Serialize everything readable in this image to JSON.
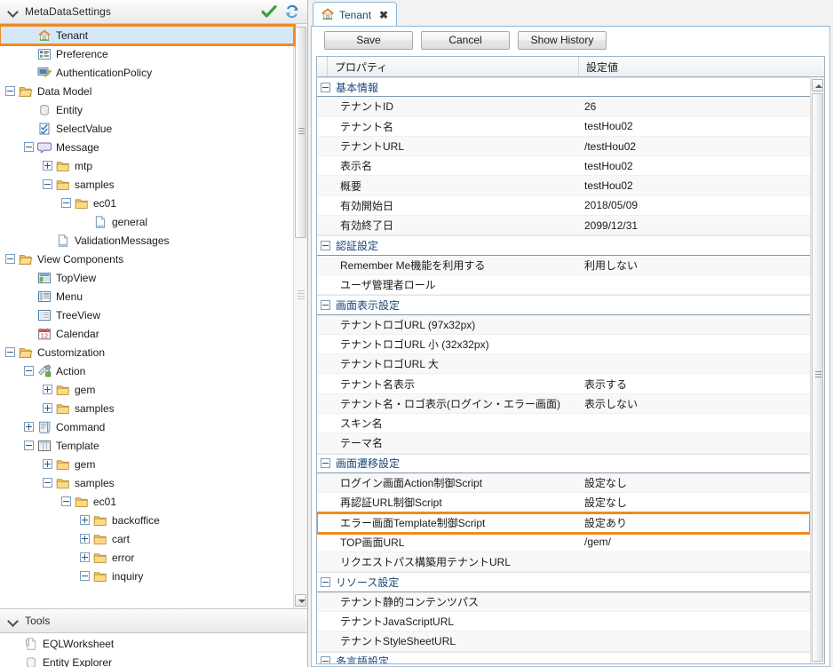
{
  "left_panel": {
    "metadata_section": {
      "title": "MetaDataSettings",
      "validate_icon": "check-icon",
      "refresh_icon": "refresh-icon"
    },
    "tree": [
      {
        "label": "Tenant",
        "depth": 1,
        "twist": "none",
        "icon": "home-icon",
        "selected": true,
        "highlighted": true
      },
      {
        "label": "Preference",
        "depth": 1,
        "twist": "none",
        "icon": "preference-icon"
      },
      {
        "label": "AuthenticationPolicy",
        "depth": 1,
        "twist": "none",
        "icon": "auth-policy-icon"
      },
      {
        "label": "Data Model",
        "depth": 0,
        "twist": "minus",
        "icon": "folder-open-icon"
      },
      {
        "label": "Entity",
        "depth": 1,
        "twist": "none",
        "icon": "entity-icon"
      },
      {
        "label": "SelectValue",
        "depth": 1,
        "twist": "none",
        "icon": "selectvalue-icon"
      },
      {
        "label": "Message",
        "depth": 1,
        "twist": "minus",
        "icon": "message-icon"
      },
      {
        "label": "mtp",
        "depth": 2,
        "twist": "plus",
        "icon": "folder-icon"
      },
      {
        "label": "samples",
        "depth": 2,
        "twist": "minus",
        "icon": "folder-icon"
      },
      {
        "label": "ec01",
        "depth": 3,
        "twist": "minus",
        "icon": "folder-icon"
      },
      {
        "label": "general",
        "depth": 4,
        "twist": "none",
        "icon": "file-icon"
      },
      {
        "label": "ValidationMessages",
        "depth": 2,
        "twist": "none",
        "icon": "file-icon"
      },
      {
        "label": "View Components",
        "depth": 0,
        "twist": "minus",
        "icon": "folder-open-icon"
      },
      {
        "label": "TopView",
        "depth": 1,
        "twist": "none",
        "icon": "topview-icon"
      },
      {
        "label": "Menu",
        "depth": 1,
        "twist": "none",
        "icon": "menu-icon"
      },
      {
        "label": "TreeView",
        "depth": 1,
        "twist": "none",
        "icon": "treeview-icon"
      },
      {
        "label": "Calendar",
        "depth": 1,
        "twist": "none",
        "icon": "calendar-icon"
      },
      {
        "label": "Customization",
        "depth": 0,
        "twist": "minus",
        "icon": "folder-open-icon"
      },
      {
        "label": "Action",
        "depth": 1,
        "twist": "minus",
        "icon": "action-icon"
      },
      {
        "label": "gem",
        "depth": 2,
        "twist": "plus",
        "icon": "folder-icon"
      },
      {
        "label": "samples",
        "depth": 2,
        "twist": "plus",
        "icon": "folder-icon"
      },
      {
        "label": "Command",
        "depth": 1,
        "twist": "plus",
        "icon": "command-icon"
      },
      {
        "label": "Template",
        "depth": 1,
        "twist": "minus",
        "icon": "template-icon"
      },
      {
        "label": "gem",
        "depth": 2,
        "twist": "plus",
        "icon": "folder-icon"
      },
      {
        "label": "samples",
        "depth": 2,
        "twist": "minus",
        "icon": "folder-icon"
      },
      {
        "label": "ec01",
        "depth": 3,
        "twist": "minus",
        "icon": "folder-icon"
      },
      {
        "label": "backoffice",
        "depth": 4,
        "twist": "plus",
        "icon": "folder-icon"
      },
      {
        "label": "cart",
        "depth": 4,
        "twist": "plus",
        "icon": "folder-icon"
      },
      {
        "label": "error",
        "depth": 4,
        "twist": "plus",
        "icon": "folder-icon"
      },
      {
        "label": "inquiry",
        "depth": 4,
        "twist": "minus",
        "icon": "folder-icon"
      }
    ],
    "tools_section": {
      "title": "Tools",
      "items": [
        {
          "label": "EQLWorksheet",
          "icon": "worksheet-icon"
        },
        {
          "label": "Entity Explorer",
          "icon": "entity-explorer-icon"
        }
      ]
    }
  },
  "right_panel": {
    "tab": {
      "label": "Tenant",
      "icon": "home-icon",
      "close": "✖"
    },
    "toolbar": {
      "save_label": "Save",
      "cancel_label": "Cancel",
      "history_label": "Show History"
    },
    "grid": {
      "columns": [
        "プロパティ",
        "設定値"
      ],
      "rows": [
        {
          "type": "group",
          "name": "基本情報",
          "value": ""
        },
        {
          "type": "item",
          "name": "テナントID",
          "value": "26"
        },
        {
          "type": "item",
          "name": "テナント名",
          "value": "testHou02"
        },
        {
          "type": "item",
          "name": "テナントURL",
          "value": "/testHou02"
        },
        {
          "type": "item",
          "name": "表示名",
          "value": "testHou02"
        },
        {
          "type": "item",
          "name": "概要",
          "value": "testHou02"
        },
        {
          "type": "item",
          "name": "有効開始日",
          "value": "2018/05/09"
        },
        {
          "type": "item",
          "name": "有効終了日",
          "value": "2099/12/31"
        },
        {
          "type": "group",
          "name": "認証設定",
          "value": ""
        },
        {
          "type": "item",
          "name": "Remember Me機能を利用する",
          "value": "利用しない"
        },
        {
          "type": "item",
          "name": "ユーザ管理者ロール",
          "value": ""
        },
        {
          "type": "group",
          "name": "画面表示設定",
          "value": ""
        },
        {
          "type": "item",
          "name": "テナントロゴURL (97x32px)",
          "value": ""
        },
        {
          "type": "item",
          "name": "テナントロゴURL 小 (32x32px)",
          "value": ""
        },
        {
          "type": "item",
          "name": "テナントロゴURL 大",
          "value": ""
        },
        {
          "type": "item",
          "name": "テナント名表示",
          "value": "表示する"
        },
        {
          "type": "item",
          "name": "テナント名・ロゴ表示(ログイン・エラー画面)",
          "value": "表示しない"
        },
        {
          "type": "item",
          "name": "スキン名",
          "value": ""
        },
        {
          "type": "item",
          "name": "テーマ名",
          "value": ""
        },
        {
          "type": "group",
          "name": "画面遷移設定",
          "value": ""
        },
        {
          "type": "item",
          "name": "ログイン画面Action制御Script",
          "value": "設定なし"
        },
        {
          "type": "item",
          "name": "再認証URL制御Script",
          "value": "設定なし"
        },
        {
          "type": "item",
          "name": "エラー画面Template制御Script",
          "value": "設定あり",
          "highlighted": true
        },
        {
          "type": "item",
          "name": "TOP画面URL",
          "value": "/gem/"
        },
        {
          "type": "item",
          "name": "リクエストパス構築用テナントURL",
          "value": ""
        },
        {
          "type": "group",
          "name": "リソース設定",
          "value": ""
        },
        {
          "type": "item",
          "name": "テナント静的コンテンツパス",
          "value": ""
        },
        {
          "type": "item",
          "name": "テナントJavaScriptURL",
          "value": ""
        },
        {
          "type": "item",
          "name": "テナントStyleSheetURL",
          "value": ""
        },
        {
          "type": "group",
          "name": "多言語設定",
          "value": ""
        }
      ]
    }
  },
  "colors": {
    "highlight_orange": "#f08a24",
    "selection_blue": "#d6e8f7",
    "group_text": "#17457a",
    "tab_text": "#17486b"
  }
}
